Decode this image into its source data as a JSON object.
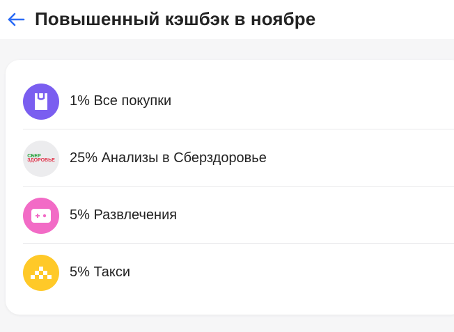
{
  "header": {
    "title": "Повышенный кэшбэк в ноябре",
    "back_icon": "arrow-left-icon"
  },
  "colors": {
    "accent": "#2c6cf6",
    "purchases_bg": "#7a5ef0",
    "sberzdorovye_bg": "#ececee",
    "entertainment_bg": "#f26bc6",
    "taxi_bg": "#ffc928"
  },
  "cashback": {
    "items": [
      {
        "label": "1% Все покупки",
        "icon": "shopping-bag-icon"
      },
      {
        "label": "25% Анализы в Сберздоровье",
        "icon": "sberzdorovye-logo",
        "logo_line1": "СБЕР",
        "logo_line2": "ЗДОРОВЬЕ"
      },
      {
        "label": "5% Развлечения",
        "icon": "gamepad-icon"
      },
      {
        "label": "5% Такси",
        "icon": "taxi-checker-icon"
      }
    ]
  }
}
